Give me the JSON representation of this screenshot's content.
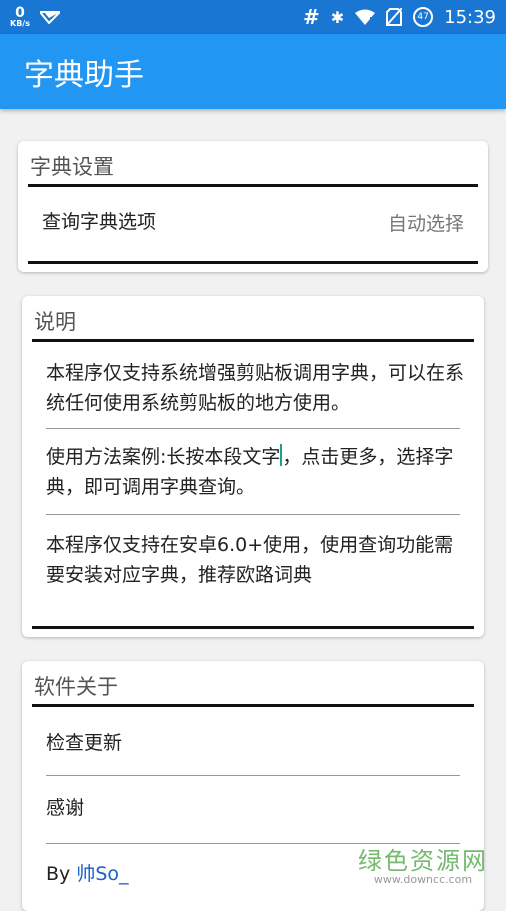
{
  "statusbar": {
    "speed_value": "0",
    "speed_unit": "KB/s",
    "hash": "#",
    "bluetooth": "✱",
    "battery": "47",
    "time": "15:39"
  },
  "app": {
    "title": "字典助手"
  },
  "dict_settings": {
    "title": "字典设置",
    "option_label": "查询字典选项",
    "option_value": "自动选择"
  },
  "description": {
    "title": "说明",
    "para1": "本程序仅支持系统增强剪贴板调用字典，可以在系统任何使用系统剪贴板的地方使用。",
    "para2_a": "使用方法案例:长按本段文字",
    "para2_b": "，点击更多，选择字典，即可调用字典查询。",
    "para3": "本程序仅支持在安卓6.0+使用，使用查询功能需要安装对应字典，推荐欧路词典"
  },
  "about": {
    "title": "软件关于",
    "check_update": "检查更新",
    "thanks": "感谢",
    "by_label": "By ",
    "author": "帅So_"
  },
  "watermark": {
    "cn": "绿色资源网",
    "url": "www.downcc.com"
  }
}
